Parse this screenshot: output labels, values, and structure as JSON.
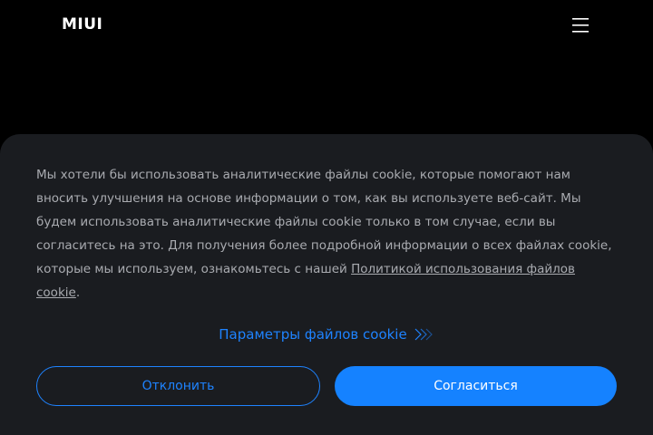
{
  "header": {
    "logo_text": "MIUI",
    "menu_icon": "hamburger-menu-icon"
  },
  "cookie_banner": {
    "text": "Мы хотели бы использовать аналитические файлы cookie, которые помогают нам вносить улучшения на основе информации о том, как вы используете веб-сайт. Мы будем использовать аналитические файлы cookie только в том случае, если вы согласитесь на это. Для получения более подробной информации о всех файлах cookie, которые мы используем, ознакомьтесь с нашей ",
    "policy_link": "Политикой использования файлов cookie",
    "text_end": ".",
    "settings_label": "Параметры файлов cookie",
    "settings_icon": "double-chevron-right-icon",
    "decline_label": "Отклонить",
    "accept_label": "Согласиться"
  },
  "colors": {
    "background": "#000000",
    "panel": "#1a1c20",
    "accent": "#1582ff",
    "text_muted": "#a9abb0"
  }
}
